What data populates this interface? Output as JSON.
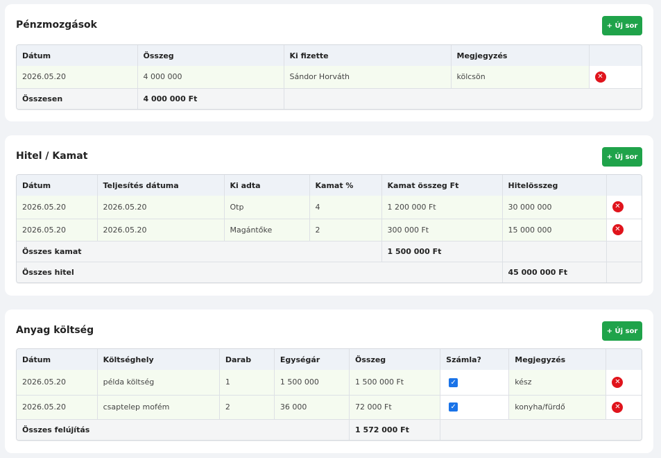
{
  "section1": {
    "title": "Pénzmozgások",
    "add_label": "+ Új sor",
    "headers": [
      "Dátum",
      "Összeg",
      "Ki fizette",
      "Megjegyzés"
    ],
    "rows": [
      {
        "date": "2026.05.20",
        "amount": "4 000 000",
        "payer": "Sándor Horváth",
        "note": "kölcsön"
      }
    ],
    "total_label": "Összesen",
    "total_value": "4 000 000 Ft"
  },
  "section2": {
    "title": "Hitel / Kamat",
    "add_label": "+ Új sor",
    "headers": [
      "Dátum",
      "Teljesítés dátuma",
      "Ki adta",
      "Kamat %",
      "Kamat összeg Ft",
      "Hitelösszeg"
    ],
    "rows": [
      {
        "date": "2026.05.20",
        "completion_date": "2026.05.20",
        "lender": "Otp",
        "rate": "4",
        "interest": "1 200 000 Ft",
        "loan": "30 000 000"
      },
      {
        "date": "2026.05.20",
        "completion_date": "2026.05.20",
        "lender": "Magántőke",
        "rate": "2",
        "interest": "300 000 Ft",
        "loan": "15 000 000"
      }
    ],
    "total_interest_label": "Összes kamat",
    "total_interest_value": "1 500 000 Ft",
    "total_loan_label": "Összes hitel",
    "total_loan_value": "45 000 000 Ft"
  },
  "section3": {
    "title": "Anyag költség",
    "add_label": "+ Új sor",
    "headers": [
      "Dátum",
      "Költséghely",
      "Darab",
      "Egységár",
      "Összeg",
      "Számla?",
      "Megjegyzés"
    ],
    "rows": [
      {
        "date": "2026.05.20",
        "cost_center": "példa költség",
        "qty": "1",
        "unit_price": "1 500 000",
        "amount": "1 500 000 Ft",
        "invoice": true,
        "note": "kész"
      },
      {
        "date": "2026.05.20",
        "cost_center": "csaptelep mofém",
        "qty": "2",
        "unit_price": "36 000",
        "amount": "72 000 Ft",
        "invoice": true,
        "note": "konyha/fürdő"
      }
    ],
    "total_label": "Összes felújítás",
    "total_value": "1 572 000 Ft"
  },
  "icons": {
    "delete": "close-circle-icon",
    "checkbox": "checkbox-checked-icon"
  },
  "colors": {
    "accent_green": "#1fa34a",
    "delete_red": "#e0141c",
    "checkbox_blue": "#1a73e8",
    "row_tint": "#f5fbf0"
  }
}
